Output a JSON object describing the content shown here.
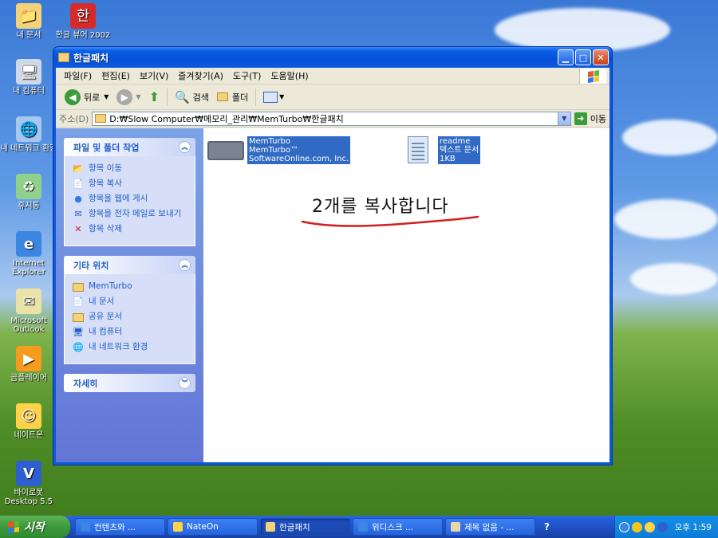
{
  "desktop": {
    "icons": [
      {
        "label": "내 문서"
      },
      {
        "label": "한글 뷰어 2002"
      },
      {
        "label": "내 컴퓨터"
      },
      {
        "label": "내 네트워크 환경"
      },
      {
        "label": "휴지통"
      },
      {
        "label": "Internet Explorer"
      },
      {
        "label": "Microsoft Outlook"
      },
      {
        "label": "곰플레이어"
      },
      {
        "label": "네이트온"
      },
      {
        "label": "바이로봇 Desktop 5.5"
      }
    ]
  },
  "window": {
    "title": "한글패치",
    "menu": [
      "파일(F)",
      "편집(E)",
      "보기(V)",
      "즐겨찾기(A)",
      "도구(T)",
      "도움말(H)"
    ],
    "toolbar": {
      "back": "뒤로",
      "search": "검색",
      "folders": "폴더"
    },
    "address": {
      "label": "주소(D)",
      "value": "D:₩Slow Computer₩메모리_관리₩MemTurbo₩한글패치",
      "go": "이동"
    },
    "taskpane": {
      "file_tasks": {
        "title": "파일 및 폴더 작업",
        "items": [
          "항목 이동",
          "항목 복사",
          "항목을 웹에 게시",
          "항목을 전자 메일로 보내기",
          "항목 삭제"
        ]
      },
      "other_places": {
        "title": "기타 위치",
        "items": [
          "MemTurbo",
          "내 문서",
          "공유 문서",
          "내 컴퓨터",
          "내 네트워크 환경"
        ]
      },
      "details": {
        "title": "자세히"
      }
    },
    "files": [
      {
        "name": "MemTurbo",
        "line2": "MemTurbo™",
        "line3": "SoftwareOnline.com, Inc."
      },
      {
        "name": "readme",
        "line2": "텍스트 문서",
        "line3": "1KB"
      }
    ],
    "annotation": "2개를 복사합니다"
  },
  "taskbar": {
    "start": "시작",
    "tasks": [
      "컨텐츠와 ...",
      "NateOn",
      "한글패치",
      "위디스크 ...",
      "제목 없음 - ..."
    ],
    "clock": "오후 1:59"
  },
  "colors": {
    "selection": "#316ac5",
    "taskpane_link": "#215dc6",
    "annotation_underline": "#d21f1f"
  }
}
